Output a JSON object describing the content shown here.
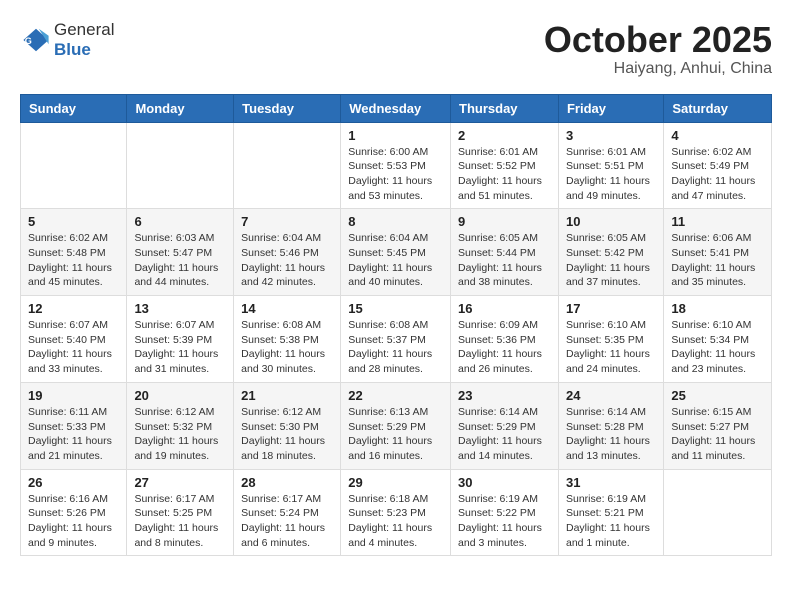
{
  "logo": {
    "text_general": "General",
    "text_blue": "Blue"
  },
  "title": {
    "month": "October 2025",
    "location": "Haiyang, Anhui, China"
  },
  "headers": [
    "Sunday",
    "Monday",
    "Tuesday",
    "Wednesday",
    "Thursday",
    "Friday",
    "Saturday"
  ],
  "weeks": [
    [
      {
        "day": "",
        "info": ""
      },
      {
        "day": "",
        "info": ""
      },
      {
        "day": "",
        "info": ""
      },
      {
        "day": "1",
        "info": "Sunrise: 6:00 AM\nSunset: 5:53 PM\nDaylight: 11 hours and 53 minutes."
      },
      {
        "day": "2",
        "info": "Sunrise: 6:01 AM\nSunset: 5:52 PM\nDaylight: 11 hours and 51 minutes."
      },
      {
        "day": "3",
        "info": "Sunrise: 6:01 AM\nSunset: 5:51 PM\nDaylight: 11 hours and 49 minutes."
      },
      {
        "day": "4",
        "info": "Sunrise: 6:02 AM\nSunset: 5:49 PM\nDaylight: 11 hours and 47 minutes."
      }
    ],
    [
      {
        "day": "5",
        "info": "Sunrise: 6:02 AM\nSunset: 5:48 PM\nDaylight: 11 hours and 45 minutes."
      },
      {
        "day": "6",
        "info": "Sunrise: 6:03 AM\nSunset: 5:47 PM\nDaylight: 11 hours and 44 minutes."
      },
      {
        "day": "7",
        "info": "Sunrise: 6:04 AM\nSunset: 5:46 PM\nDaylight: 11 hours and 42 minutes."
      },
      {
        "day": "8",
        "info": "Sunrise: 6:04 AM\nSunset: 5:45 PM\nDaylight: 11 hours and 40 minutes."
      },
      {
        "day": "9",
        "info": "Sunrise: 6:05 AM\nSunset: 5:44 PM\nDaylight: 11 hours and 38 minutes."
      },
      {
        "day": "10",
        "info": "Sunrise: 6:05 AM\nSunset: 5:42 PM\nDaylight: 11 hours and 37 minutes."
      },
      {
        "day": "11",
        "info": "Sunrise: 6:06 AM\nSunset: 5:41 PM\nDaylight: 11 hours and 35 minutes."
      }
    ],
    [
      {
        "day": "12",
        "info": "Sunrise: 6:07 AM\nSunset: 5:40 PM\nDaylight: 11 hours and 33 minutes."
      },
      {
        "day": "13",
        "info": "Sunrise: 6:07 AM\nSunset: 5:39 PM\nDaylight: 11 hours and 31 minutes."
      },
      {
        "day": "14",
        "info": "Sunrise: 6:08 AM\nSunset: 5:38 PM\nDaylight: 11 hours and 30 minutes."
      },
      {
        "day": "15",
        "info": "Sunrise: 6:08 AM\nSunset: 5:37 PM\nDaylight: 11 hours and 28 minutes."
      },
      {
        "day": "16",
        "info": "Sunrise: 6:09 AM\nSunset: 5:36 PM\nDaylight: 11 hours and 26 minutes."
      },
      {
        "day": "17",
        "info": "Sunrise: 6:10 AM\nSunset: 5:35 PM\nDaylight: 11 hours and 24 minutes."
      },
      {
        "day": "18",
        "info": "Sunrise: 6:10 AM\nSunset: 5:34 PM\nDaylight: 11 hours and 23 minutes."
      }
    ],
    [
      {
        "day": "19",
        "info": "Sunrise: 6:11 AM\nSunset: 5:33 PM\nDaylight: 11 hours and 21 minutes."
      },
      {
        "day": "20",
        "info": "Sunrise: 6:12 AM\nSunset: 5:32 PM\nDaylight: 11 hours and 19 minutes."
      },
      {
        "day": "21",
        "info": "Sunrise: 6:12 AM\nSunset: 5:30 PM\nDaylight: 11 hours and 18 minutes."
      },
      {
        "day": "22",
        "info": "Sunrise: 6:13 AM\nSunset: 5:29 PM\nDaylight: 11 hours and 16 minutes."
      },
      {
        "day": "23",
        "info": "Sunrise: 6:14 AM\nSunset: 5:29 PM\nDaylight: 11 hours and 14 minutes."
      },
      {
        "day": "24",
        "info": "Sunrise: 6:14 AM\nSunset: 5:28 PM\nDaylight: 11 hours and 13 minutes."
      },
      {
        "day": "25",
        "info": "Sunrise: 6:15 AM\nSunset: 5:27 PM\nDaylight: 11 hours and 11 minutes."
      }
    ],
    [
      {
        "day": "26",
        "info": "Sunrise: 6:16 AM\nSunset: 5:26 PM\nDaylight: 11 hours and 9 minutes."
      },
      {
        "day": "27",
        "info": "Sunrise: 6:17 AM\nSunset: 5:25 PM\nDaylight: 11 hours and 8 minutes."
      },
      {
        "day": "28",
        "info": "Sunrise: 6:17 AM\nSunset: 5:24 PM\nDaylight: 11 hours and 6 minutes."
      },
      {
        "day": "29",
        "info": "Sunrise: 6:18 AM\nSunset: 5:23 PM\nDaylight: 11 hours and 4 minutes."
      },
      {
        "day": "30",
        "info": "Sunrise: 6:19 AM\nSunset: 5:22 PM\nDaylight: 11 hours and 3 minutes."
      },
      {
        "day": "31",
        "info": "Sunrise: 6:19 AM\nSunset: 5:21 PM\nDaylight: 11 hours and 1 minute."
      },
      {
        "day": "",
        "info": ""
      }
    ]
  ]
}
